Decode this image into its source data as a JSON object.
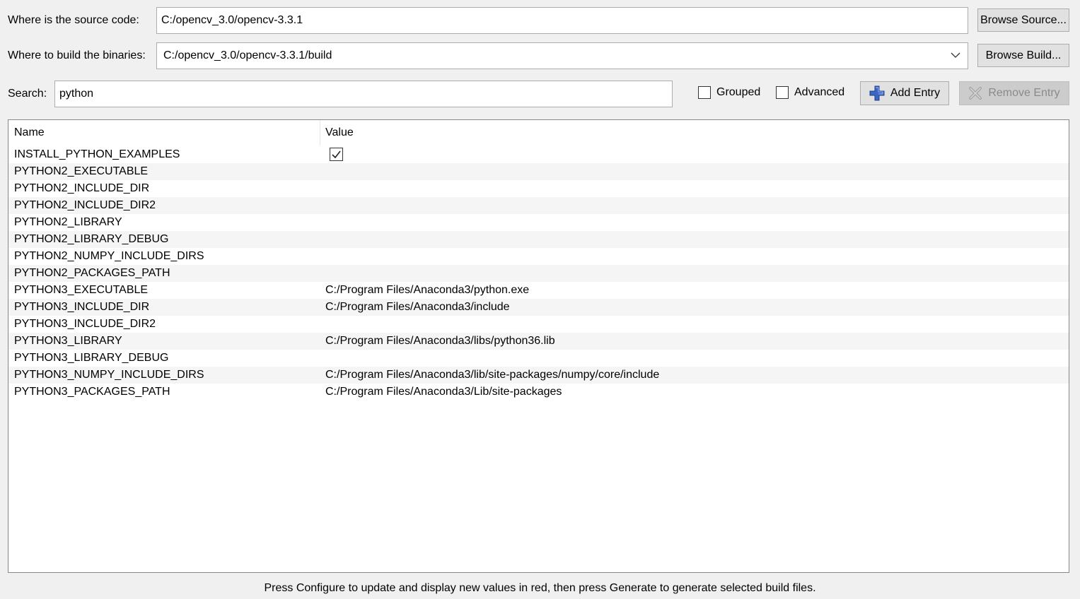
{
  "source": {
    "label": "Where is the source code:",
    "value": "C:/opencv_3.0/opencv-3.3.1",
    "browse_label": "Browse Source..."
  },
  "build": {
    "label": "Where to build the binaries:",
    "value": "C:/opencv_3.0/opencv-3.3.1/build",
    "browse_label": "Browse Build..."
  },
  "search": {
    "label": "Search:",
    "value": "python"
  },
  "options": {
    "grouped": {
      "label": "Grouped",
      "checked": false
    },
    "advanced": {
      "label": "Advanced",
      "checked": false
    }
  },
  "actions": {
    "add_label": "Add Entry",
    "remove_label": "Remove Entry"
  },
  "table": {
    "headers": {
      "name": "Name",
      "value": "Value"
    },
    "rows": [
      {
        "name": "INSTALL_PYTHON_EXAMPLES",
        "value": "",
        "bool": true
      },
      {
        "name": "PYTHON2_EXECUTABLE",
        "value": ""
      },
      {
        "name": "PYTHON2_INCLUDE_DIR",
        "value": ""
      },
      {
        "name": "PYTHON2_INCLUDE_DIR2",
        "value": ""
      },
      {
        "name": "PYTHON2_LIBRARY",
        "value": ""
      },
      {
        "name": "PYTHON2_LIBRARY_DEBUG",
        "value": ""
      },
      {
        "name": "PYTHON2_NUMPY_INCLUDE_DIRS",
        "value": ""
      },
      {
        "name": "PYTHON2_PACKAGES_PATH",
        "value": ""
      },
      {
        "name": "PYTHON3_EXECUTABLE",
        "value": "C:/Program Files/Anaconda3/python.exe"
      },
      {
        "name": "PYTHON3_INCLUDE_DIR",
        "value": "C:/Program Files/Anaconda3/include"
      },
      {
        "name": "PYTHON3_INCLUDE_DIR2",
        "value": ""
      },
      {
        "name": "PYTHON3_LIBRARY",
        "value": "C:/Program Files/Anaconda3/libs/python36.lib"
      },
      {
        "name": "PYTHON3_LIBRARY_DEBUG",
        "value": ""
      },
      {
        "name": "PYTHON3_NUMPY_INCLUDE_DIRS",
        "value": "C:/Program Files/Anaconda3/lib/site-packages/numpy/core/include"
      },
      {
        "name": "PYTHON3_PACKAGES_PATH",
        "value": "C:/Program Files/Anaconda3/Lib/site-packages"
      }
    ]
  },
  "status_text": "Press Configure to update and display new values in red, then press Generate to generate selected build files.",
  "icons": {
    "add": "plus-icon",
    "remove": "remove-x-icon",
    "dropdown": "chevron-down-icon",
    "check": "checkmark-icon"
  },
  "colors": {
    "add_icon": "#3a66c4",
    "disabled_text": "#8a8a8a"
  }
}
